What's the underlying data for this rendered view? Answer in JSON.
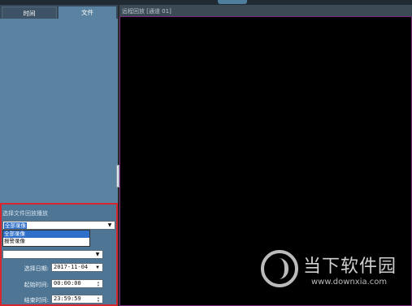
{
  "tabs": {
    "time_label": "时间",
    "file_label": "文件"
  },
  "panel": {
    "title": "选择文件回放播放",
    "combo_value": "全部录像",
    "dropdown_arrow": "▼",
    "options": [
      "全部录像",
      "报警录像"
    ],
    "date_label": "选择日期:",
    "date_value": "2017-11-04",
    "start_label": "起始时间:",
    "start_value": "00:00:00",
    "end_label": "结束时间:",
    "end_value": "23:59:59"
  },
  "video": {
    "header": "远程回放 [通道 01]"
  },
  "watermark": {
    "brand": "当下软件园",
    "url": "www.downxia.com"
  },
  "colors": {
    "sidebar": "#5a82a1",
    "highlight": "#d8262f",
    "selection": "#2d6fc9",
    "video_bg": "#000000"
  }
}
